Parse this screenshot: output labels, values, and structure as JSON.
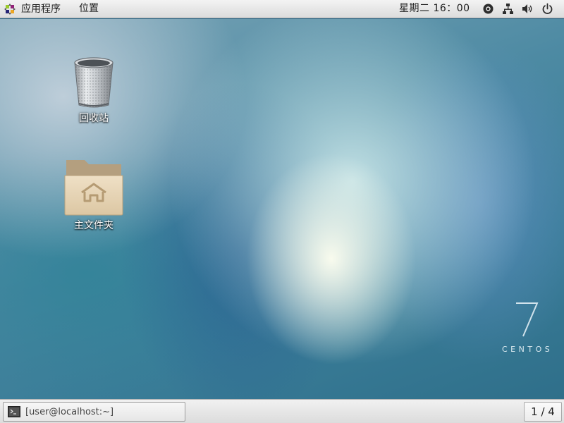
{
  "top_panel": {
    "apps_label": "应用程序",
    "places_label": "位置",
    "clock": "星期二 16：00",
    "tray_icons": [
      "accessibility-icon",
      "network-icon",
      "volume-icon",
      "power-icon"
    ]
  },
  "desktop": {
    "icons": [
      {
        "label": "回收站",
        "icon": "trash-icon"
      },
      {
        "label": "主文件夹",
        "icon": "home-folder-icon"
      }
    ],
    "branding": {
      "number": "7",
      "word": "CENTOS"
    }
  },
  "bottom_panel": {
    "task_label": "[user@localhost:~]",
    "task_icon": "terminal-icon",
    "workspace": "1 / 4"
  }
}
